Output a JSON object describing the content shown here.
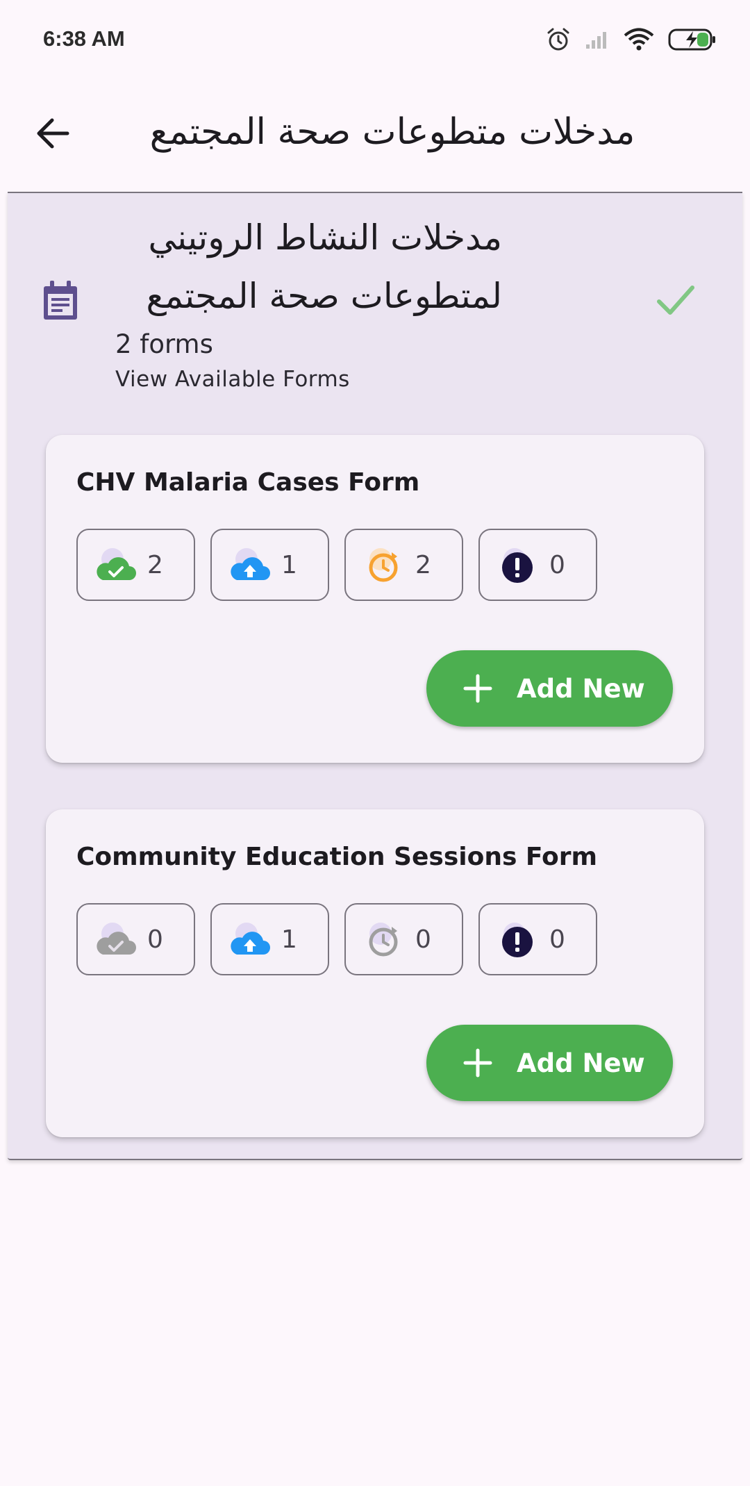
{
  "status_bar": {
    "time": "6:38 AM",
    "icons": [
      "alarm-icon",
      "signal-icon",
      "wifi-icon",
      "battery-charging-icon"
    ]
  },
  "app_bar": {
    "title": "مدخلات متطوعات صحة المجتمع",
    "back_icon": "arrow-back-icon"
  },
  "section": {
    "title": "مدخلات النشاط الروتيني لمتطوعات صحة المجتمع",
    "forms_count": "2 forms",
    "subtitle": "View Available Forms",
    "icon": "calendar-form-icon",
    "status_icon": "check-icon",
    "status_color": "#81c784"
  },
  "forms": [
    {
      "title": "CHV Malaria Cases Form",
      "chips": [
        {
          "icon": "cloud-check-icon",
          "count": "2",
          "color": "#4caf50"
        },
        {
          "icon": "cloud-upload-icon",
          "count": "1",
          "color": "#2196f3"
        },
        {
          "icon": "pending-clock-icon",
          "count": "2",
          "color": "#f7a230"
        },
        {
          "icon": "error-icon",
          "count": "0",
          "color": "#1a1340"
        }
      ],
      "add_label": "Add New"
    },
    {
      "title": "Community Education Sessions Form",
      "chips": [
        {
          "icon": "cloud-check-icon",
          "count": "0",
          "color": "#9e9e9e"
        },
        {
          "icon": "cloud-upload-icon",
          "count": "1",
          "color": "#2196f3"
        },
        {
          "icon": "pending-clock-icon",
          "count": "0",
          "color": "#9e9e9e"
        },
        {
          "icon": "error-icon",
          "count": "0",
          "color": "#1a1340"
        }
      ],
      "add_label": "Add New"
    }
  ],
  "colors": {
    "accent_green": "#4caf50",
    "section_bg": "#ebe4f1",
    "card_bg": "#f6f1f8",
    "icon_purple": "#5e4f8e"
  }
}
